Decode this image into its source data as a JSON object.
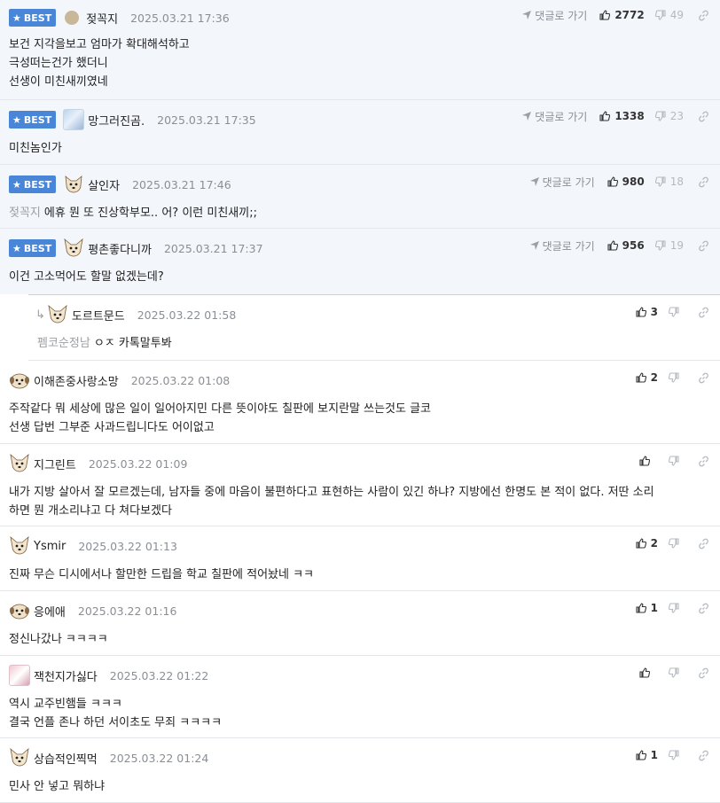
{
  "best_label": "BEST",
  "goto_label": "댓글로 가기",
  "comments": [
    {
      "nick": "젖꼭지",
      "date": "2025.03.21 17:36",
      "likes": "2772",
      "hates": "49",
      "lines": [
        "보건 지각을보고 엄마가 확대해석하고",
        "극성떠는건가 했더니",
        "선생이 미친새끼였네"
      ]
    },
    {
      "nick": "망그러진곰.",
      "date": "2025.03.21 17:35",
      "likes": "1338",
      "hates": "23",
      "lines": [
        "미친놈인가"
      ]
    },
    {
      "nick": "살인자",
      "date": "2025.03.21 17:46",
      "likes": "980",
      "hates": "18",
      "mention": "젖꼭지",
      "lines": [
        "에휴 뭔 또 진상학부모.. 어? 이런 미친새끼;;"
      ]
    },
    {
      "nick": "평촌좋다니까",
      "date": "2025.03.21 17:37",
      "likes": "956",
      "hates": "19",
      "lines": [
        "이건 고소먹어도 할말 없겠는데?"
      ]
    },
    {
      "nick": "도르트문드",
      "date": "2025.03.22 01:58",
      "likes": "3",
      "mention": "펨코순정남",
      "lines": [
        "ㅇㅈ 카톡말투봐"
      ]
    },
    {
      "nick": "이해존중사랑소망",
      "date": "2025.03.22 01:08",
      "likes": "2",
      "lines": [
        "주작같다 뭐 세상에 많은 일이 일어아지민 다른 뜻이야도 칠판에 보지란말 쓰는것도 글코",
        "선생 답번 그부준 사과드립니다도 어이없고"
      ]
    },
    {
      "nick": "지그린트",
      "date": "2025.03.22 01:09",
      "likes": "",
      "lines": [
        "내가 지방 살아서 잘 모르겠는데, 남자들 중에 마음이 불편하다고 표현하는 사람이 있긴 하냐? 지방에선 한명도 본 적이 없다. 저딴 소리",
        "하면 뭔 개소리냐고 다 쳐다보겠다"
      ]
    },
    {
      "nick": "Ysmir",
      "date": "2025.03.22 01:13",
      "likes": "2",
      "lines": [
        "진짜 무슨 디시에서나 할만한 드립을 학교 칠판에 적어놨네 ㅋㅋ"
      ]
    },
    {
      "nick": "응에애",
      "date": "2025.03.22 01:16",
      "likes": "1",
      "lines": [
        "정신나갔나 ㅋㅋㅋㅋ"
      ]
    },
    {
      "nick": "잭천지가싫다",
      "date": "2025.03.22 01:22",
      "likes": "",
      "lines": [
        "역시 교주빈햄들 ㅋㅋㅋ",
        "결국 언플 존나 하던 서이초도 무죄 ㅋㅋㅋㅋ"
      ]
    },
    {
      "nick": "상습적인찍먹",
      "date": "2025.03.22 01:24",
      "likes": "1",
      "lines": [
        "민사 안 넣고 뭐하냐"
      ]
    }
  ]
}
